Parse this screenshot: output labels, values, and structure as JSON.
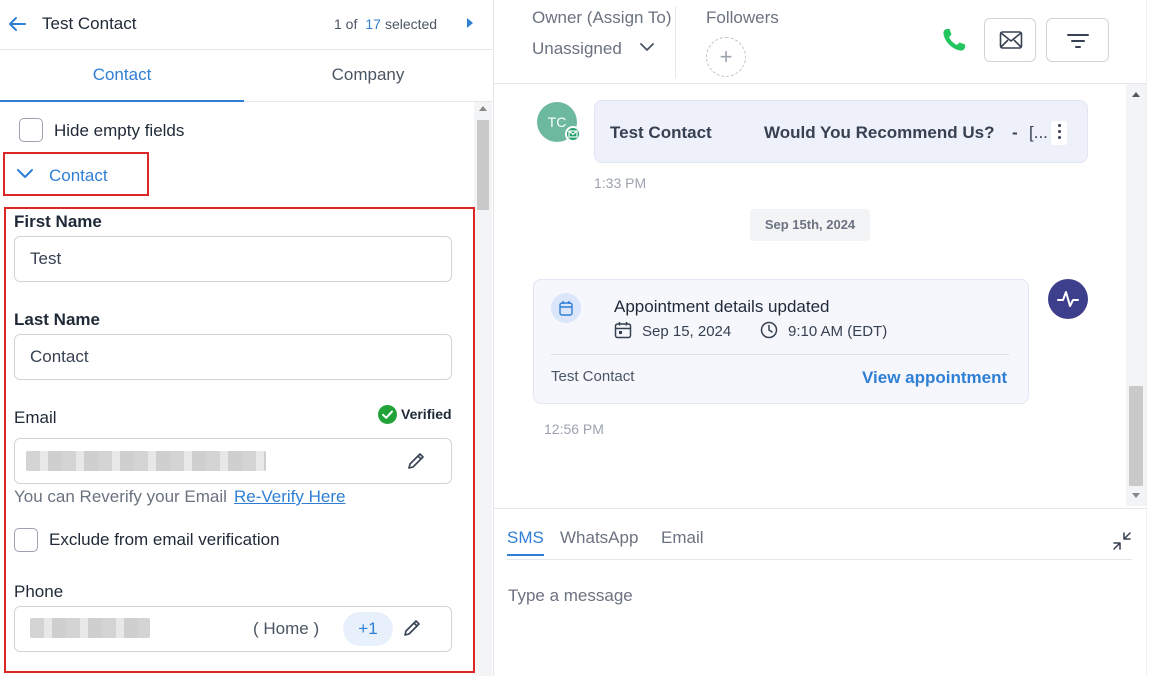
{
  "header": {
    "back_icon": "arrow-left-icon",
    "title": "Test Contact",
    "pager_prefix": "1 of",
    "pager_total": "17",
    "pager_suffix": "selected",
    "next_icon": "caret-right-icon"
  },
  "tabs": [
    {
      "label": "Contact",
      "active": true
    },
    {
      "label": "Company",
      "active": false
    }
  ],
  "form": {
    "hide_empty_label": "Hide empty fields",
    "section_label": "Contact",
    "first_name_label": "First Name",
    "first_name_value": "Test",
    "last_name_label": "Last Name",
    "last_name_value": "Contact",
    "email_label": "Email",
    "verified_label": "Verified",
    "reverify_text": "You can Reverify your Email",
    "reverify_link": "Re-Verify Here",
    "exclude_label": "Exclude from email verification",
    "phone_label": "Phone",
    "phone_type": "( Home )",
    "phone_extra": "+1"
  },
  "right_header": {
    "owner_label": "Owner (Assign To)",
    "owner_value": "Unassigned",
    "followers_label": "Followers",
    "add_follower": "+"
  },
  "conversation": {
    "avatar_initials": "TC",
    "message": {
      "sender": "Test Contact",
      "subject": "Would You Recommend Us?",
      "dash": "-",
      "truncated": "[..."
    },
    "time1": "1:33 PM",
    "date_divider": "Sep 15th, 2024",
    "appointment": {
      "title": "Appointment details updated",
      "date": "Sep 15, 2024",
      "time": "9:10 AM (EDT)",
      "contact": "Test Contact",
      "link": "View appointment"
    },
    "time2": "12:56 PM"
  },
  "composer": {
    "tabs": [
      {
        "label": "SMS",
        "active": true
      },
      {
        "label": "WhatsApp",
        "active": false
      },
      {
        "label": "Email",
        "active": false
      }
    ],
    "placeholder": "Type a message"
  },
  "colors": {
    "accent": "#2f7fd5",
    "highlight_border": "#dc2626",
    "verified_green": "#22a33a",
    "phone_green": "#22c55e",
    "activity_avatar": "#3e3f8c"
  }
}
